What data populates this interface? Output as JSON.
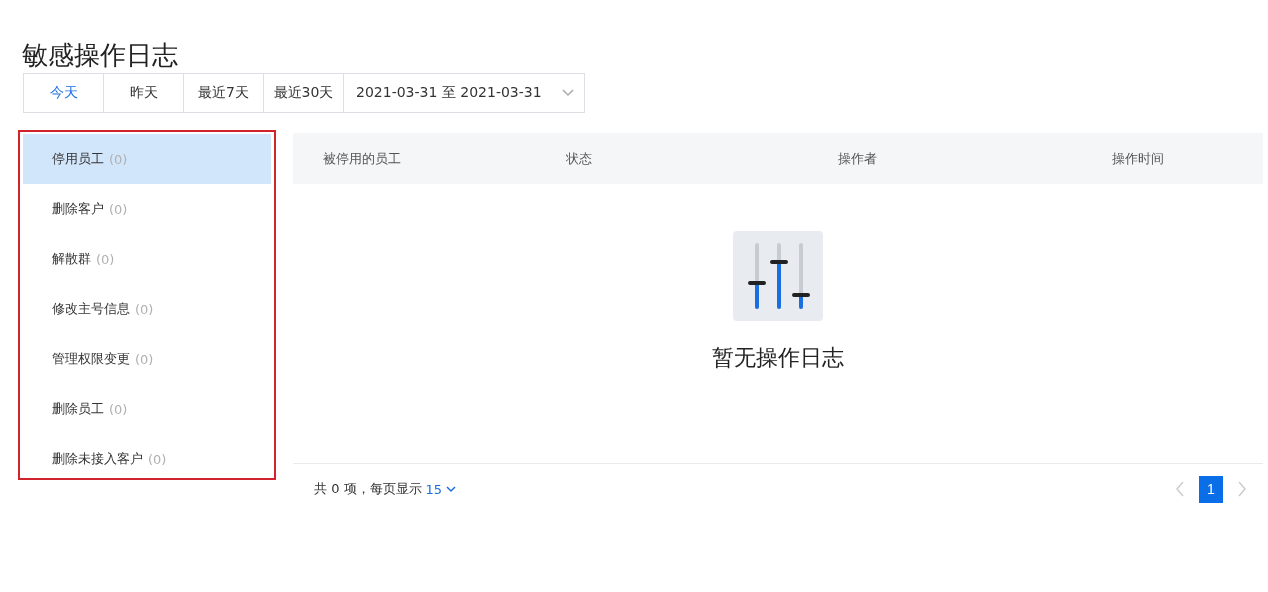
{
  "page_title": "敏感操作日志",
  "date_filters": [
    {
      "label": "今天",
      "selected": true
    },
    {
      "label": "昨天",
      "selected": false
    },
    {
      "label": "最近7天",
      "selected": false
    },
    {
      "label": "最近30天",
      "selected": false
    }
  ],
  "date_range": {
    "value": "2021-03-31 至 2021-03-31"
  },
  "sidebar": {
    "items": [
      {
        "label": "停用员工",
        "count": "(0)",
        "selected": true
      },
      {
        "label": "删除客户",
        "count": "(0)",
        "selected": false
      },
      {
        "label": "解散群",
        "count": "(0)",
        "selected": false
      },
      {
        "label": "修改主号信息",
        "count": "(0)",
        "selected": false
      },
      {
        "label": "管理权限变更",
        "count": "(0)",
        "selected": false
      },
      {
        "label": "删除员工",
        "count": "(0)",
        "selected": false
      },
      {
        "label": "删除未接入客户",
        "count": "(0)",
        "selected": false
      }
    ]
  },
  "table": {
    "columns": [
      "被停用的员工",
      "状态",
      "操作者",
      "操作时间"
    ],
    "empty_text": "暂无操作日志"
  },
  "footer": {
    "summary": "共 0 项，每页显示",
    "page_size": "15",
    "pages": [
      {
        "label": "1",
        "selected": true
      }
    ]
  }
}
